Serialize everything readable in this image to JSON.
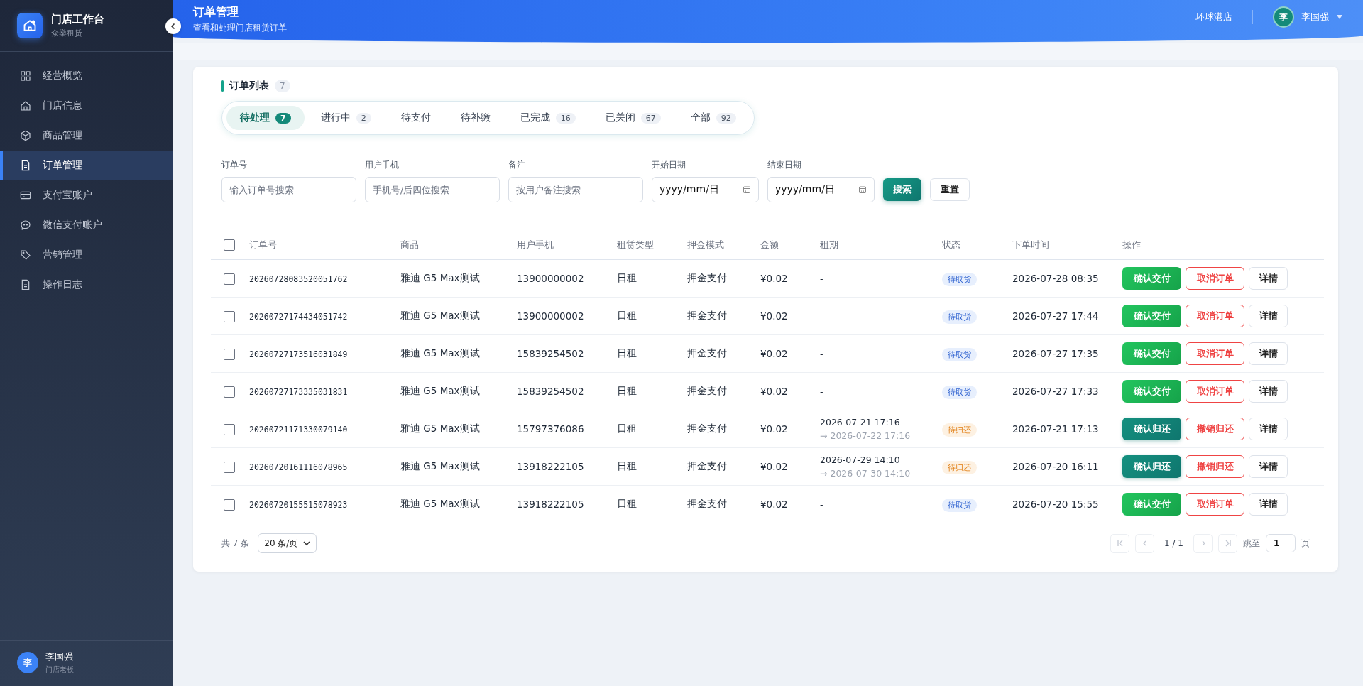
{
  "sidebar": {
    "logo_title": "门店工作台",
    "logo_subtitle": "众燊租赁",
    "items": [
      {
        "label": "经营概览",
        "selected": false
      },
      {
        "label": "门店信息",
        "selected": false
      },
      {
        "label": "商品管理",
        "selected": false
      },
      {
        "label": "订单管理",
        "selected": true
      },
      {
        "label": "支付宝账户",
        "selected": false
      },
      {
        "label": "微信支付账户",
        "selected": false
      },
      {
        "label": "营销管理",
        "selected": false
      },
      {
        "label": "操作日志",
        "selected": false
      }
    ],
    "user": {
      "avatar": "李",
      "name": "李国强",
      "role": "门店老板"
    }
  },
  "header": {
    "title": "订单管理",
    "subtitle": "查看和处理门店租赁订单",
    "store": "环球港店",
    "user": {
      "avatar": "李",
      "name": "李国强"
    }
  },
  "list": {
    "title": "订单列表",
    "count": "7",
    "tabs": [
      {
        "label": "待处理",
        "count": "7",
        "selected": true
      },
      {
        "label": "进行中",
        "count": "2",
        "selected": false
      },
      {
        "label": "待支付",
        "selected": false
      },
      {
        "label": "待补缴",
        "selected": false
      },
      {
        "label": "已完成",
        "count": "16",
        "selected": false
      },
      {
        "label": "已关闭",
        "count": "67",
        "selected": false
      },
      {
        "label": "全部",
        "count": "92",
        "selected": false
      }
    ]
  },
  "filters": [
    {
      "kind": "text",
      "label": "订单号",
      "placeholder": "输入订单号搜索"
    },
    {
      "kind": "text",
      "label": "用户手机",
      "placeholder": "手机号/后四位搜索"
    },
    {
      "kind": "text",
      "label": "备注",
      "placeholder": "按用户备注搜索"
    },
    {
      "kind": "date",
      "label": "开始日期",
      "value": "yyyy/mm/日"
    },
    {
      "kind": "date",
      "label": "结束日期",
      "value": "yyyy/mm/日"
    }
  ],
  "filter_buttons": [
    {
      "label": "搜索",
      "kind": "primary"
    },
    {
      "label": "重置",
      "kind": "default"
    }
  ],
  "table": {
    "select_all_checked": false,
    "columns": [
      "订单号",
      "商品",
      "用户手机",
      "租赁类型",
      "押金模式",
      "金额",
      "租期",
      "状态",
      "下单时间",
      "操作"
    ],
    "rows": [
      {
        "checked": false,
        "order_no": "20260728083520051762",
        "product": "雅迪 G5 Max测试",
        "phone": "13900000002",
        "rent_type": "日租",
        "deposit_mode": "押金支付",
        "amount": "¥0.02",
        "period": [
          "-"
        ],
        "status": {
          "label": "待取货",
          "kind": "pickup"
        },
        "created": "2026-07-28 08:35",
        "actions": [
          {
            "label": "确认交付",
            "kind": "green"
          },
          {
            "label": "取消订单",
            "kind": "danger"
          },
          {
            "label": "详情",
            "kind": "default"
          }
        ]
      },
      {
        "checked": false,
        "order_no": "20260727174434051742",
        "product": "雅迪 G5 Max测试",
        "phone": "13900000002",
        "rent_type": "日租",
        "deposit_mode": "押金支付",
        "amount": "¥0.02",
        "period": [
          "-"
        ],
        "status": {
          "label": "待取货",
          "kind": "pickup"
        },
        "created": "2026-07-27 17:44",
        "actions": [
          {
            "label": "确认交付",
            "kind": "green"
          },
          {
            "label": "取消订单",
            "kind": "danger"
          },
          {
            "label": "详情",
            "kind": "default"
          }
        ]
      },
      {
        "checked": false,
        "order_no": "20260727173516031849",
        "product": "雅迪 G5 Max测试",
        "phone": "15839254502",
        "rent_type": "日租",
        "deposit_mode": "押金支付",
        "amount": "¥0.02",
        "period": [
          "-"
        ],
        "status": {
          "label": "待取货",
          "kind": "pickup"
        },
        "created": "2026-07-27 17:35",
        "actions": [
          {
            "label": "确认交付",
            "kind": "green"
          },
          {
            "label": "取消订单",
            "kind": "danger"
          },
          {
            "label": "详情",
            "kind": "default"
          }
        ]
      },
      {
        "checked": false,
        "order_no": "20260727173335031831",
        "product": "雅迪 G5 Max测试",
        "phone": "15839254502",
        "rent_type": "日租",
        "deposit_mode": "押金支付",
        "amount": "¥0.02",
        "period": [
          "-"
        ],
        "status": {
          "label": "待取货",
          "kind": "pickup"
        },
        "created": "2026-07-27 17:33",
        "actions": [
          {
            "label": "确认交付",
            "kind": "green"
          },
          {
            "label": "取消订单",
            "kind": "danger"
          },
          {
            "label": "详情",
            "kind": "default"
          }
        ]
      },
      {
        "checked": false,
        "order_no": "20260721171330079140",
        "product": "雅迪 G5 Max测试",
        "phone": "15797376086",
        "rent_type": "日租",
        "deposit_mode": "押金支付",
        "amount": "¥0.02",
        "period": [
          "2026-07-21 17:16",
          "→ 2026-07-22 17:16"
        ],
        "status": {
          "label": "待归还",
          "kind": "return"
        },
        "created": "2026-07-21 17:13",
        "actions": [
          {
            "label": "确认归还",
            "kind": "teal"
          },
          {
            "label": "撤销归还",
            "kind": "danger"
          },
          {
            "label": "详情",
            "kind": "default"
          }
        ]
      },
      {
        "checked": false,
        "order_no": "20260720161116078965",
        "product": "雅迪 G5 Max测试",
        "phone": "13918222105",
        "rent_type": "日租",
        "deposit_mode": "押金支付",
        "amount": "¥0.02",
        "period": [
          "2026-07-29 14:10",
          "→ 2026-07-30 14:10"
        ],
        "status": {
          "label": "待归还",
          "kind": "return"
        },
        "created": "2026-07-20 16:11",
        "actions": [
          {
            "label": "确认归还",
            "kind": "teal"
          },
          {
            "label": "撤销归还",
            "kind": "danger"
          },
          {
            "label": "详情",
            "kind": "default"
          }
        ]
      },
      {
        "checked": false,
        "order_no": "20260720155515078923",
        "product": "雅迪 G5 Max测试",
        "phone": "13918222105",
        "rent_type": "日租",
        "deposit_mode": "押金支付",
        "amount": "¥0.02",
        "period": [
          "-"
        ],
        "status": {
          "label": "待取货",
          "kind": "pickup"
        },
        "created": "2026-07-20 15:55",
        "actions": [
          {
            "label": "确认交付",
            "kind": "green"
          },
          {
            "label": "取消订单",
            "kind": "danger"
          },
          {
            "label": "详情",
            "kind": "default"
          }
        ]
      }
    ]
  },
  "pagination": {
    "total": "共 7 条",
    "page_size": "20 条/页",
    "page": "1 / 1",
    "jump_label": "跳至",
    "jump_value": "1",
    "page_suffix": "页"
  }
}
